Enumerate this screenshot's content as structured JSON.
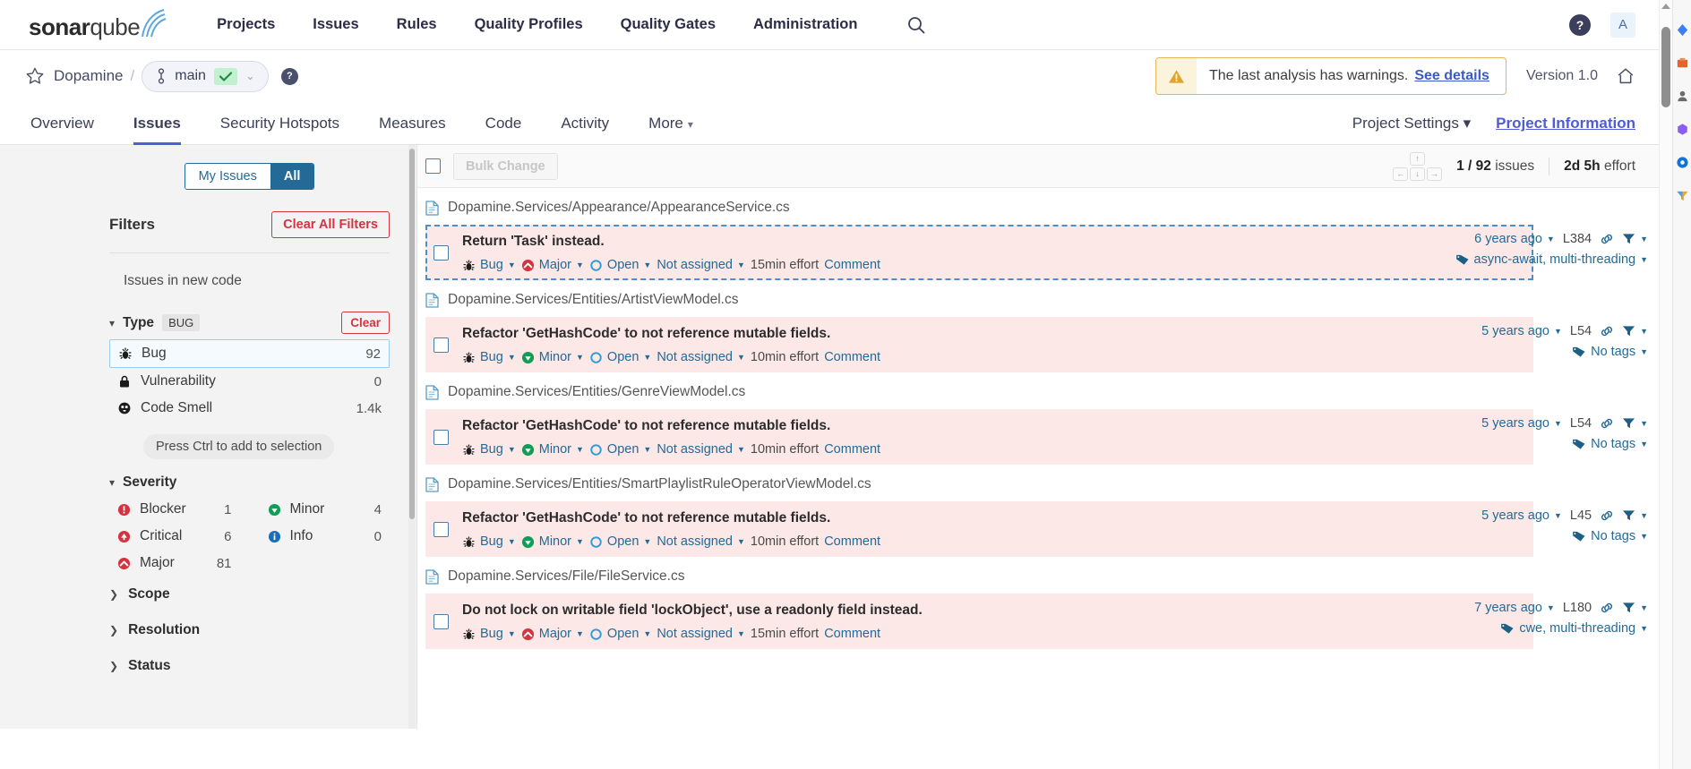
{
  "global_nav": {
    "logo_bold": "sonar",
    "logo_light": "qube",
    "links": [
      {
        "label": "Projects",
        "name": "nav-projects"
      },
      {
        "label": "Issues",
        "name": "nav-issues"
      },
      {
        "label": "Rules",
        "name": "nav-rules"
      },
      {
        "label": "Quality Profiles",
        "name": "nav-quality-profiles"
      },
      {
        "label": "Quality Gates",
        "name": "nav-quality-gates"
      },
      {
        "label": "Administration",
        "name": "nav-administration"
      }
    ],
    "search_icon": "search-icon",
    "help_label": "?",
    "avatar_label": "A"
  },
  "context": {
    "star_icon": "star-icon",
    "project_name": "Dopamine",
    "separator": "/",
    "branch": "main",
    "branch_status_icon": "check-icon",
    "branch_chevron": "⌄",
    "help_badge": "?",
    "warning_text": "The last analysis has warnings.",
    "warning_link": "See details",
    "warning_icon": "warning-triangle-icon",
    "version": "Version 1.0",
    "home_icon": "home-icon"
  },
  "tabs": {
    "items": [
      {
        "label": "Overview",
        "name": "tab-overview",
        "active": false
      },
      {
        "label": "Issues",
        "name": "tab-issues",
        "active": true
      },
      {
        "label": "Security Hotspots",
        "name": "tab-security-hotspots",
        "active": false
      },
      {
        "label": "Measures",
        "name": "tab-measures",
        "active": false
      },
      {
        "label": "Code",
        "name": "tab-code",
        "active": false
      },
      {
        "label": "Activity",
        "name": "tab-activity",
        "active": false
      },
      {
        "label": "More",
        "name": "tab-more",
        "active": false,
        "chevron": true
      }
    ],
    "project_settings": "Project Settings",
    "project_settings_chevron": "⌄",
    "project_information": "Project Information"
  },
  "sidebar": {
    "segment": {
      "my_issues": "My Issues",
      "all": "All",
      "active": "All"
    },
    "filters_title": "Filters",
    "clear_all_label": "Clear All Filters",
    "new_code_label": "Issues in new code",
    "type_facet": {
      "title": "Type",
      "chip": "BUG",
      "clear_label": "Clear",
      "items": [
        {
          "label": "Bug",
          "count": "92",
          "icon": "bug-icon",
          "selected": true
        },
        {
          "label": "Vulnerability",
          "count": "0",
          "icon": "vulnerability-icon",
          "selected": false
        },
        {
          "label": "Code Smell",
          "count": "1.4k",
          "icon": "code-smell-icon",
          "selected": false
        }
      ]
    },
    "hint": "Press Ctrl to add to selection",
    "severity_facet": {
      "title": "Severity",
      "items": [
        {
          "label": "Blocker",
          "count": "1",
          "icon": "blocker-icon"
        },
        {
          "label": "Minor",
          "count": "4",
          "icon": "minor-icon"
        },
        {
          "label": "Critical",
          "count": "6",
          "icon": "critical-icon"
        },
        {
          "label": "Info",
          "count": "0",
          "icon": "info-icon"
        },
        {
          "label": "Major",
          "count": "81",
          "icon": "major-icon"
        }
      ]
    },
    "collapsed_facets": [
      {
        "label": "Scope",
        "name": "facet-scope"
      },
      {
        "label": "Resolution",
        "name": "facet-resolution"
      },
      {
        "label": "Status",
        "name": "facet-status"
      }
    ]
  },
  "list_toolbar": {
    "bulk_change_label": "Bulk Change",
    "keys": {
      "up": "↑",
      "left": "←",
      "down": "↓",
      "right": "→"
    },
    "count_current": "1 / 92",
    "count_suffix": "issues",
    "effort_value": "2d 5h",
    "effort_suffix": "effort"
  },
  "issues": [
    {
      "file": "Dopamine.Services/Appearance/AppearanceService.cs",
      "title": "Return 'Task' instead.",
      "type": "Bug",
      "type_icon": "bug-icon",
      "severity": "Major",
      "severity_icon": "major-icon",
      "status": "Open",
      "status_icon": "open-circle-icon",
      "assignee": "Not assigned",
      "effort": "15min effort",
      "comment": "Comment",
      "age": "6 years ago",
      "line": "L384",
      "link_icon": "permalink-icon",
      "filter_icon": "filter-icon",
      "tags_icon": "tag-icon",
      "tags": "async-await, multi-threading",
      "selected": true
    },
    {
      "file": "Dopamine.Services/Entities/ArtistViewModel.cs",
      "title": "Refactor 'GetHashCode' to not reference mutable fields.",
      "type": "Bug",
      "type_icon": "bug-icon",
      "severity": "Minor",
      "severity_icon": "minor-icon",
      "status": "Open",
      "status_icon": "open-circle-icon",
      "assignee": "Not assigned",
      "effort": "10min effort",
      "comment": "Comment",
      "age": "5 years ago",
      "line": "L54",
      "link_icon": "permalink-icon",
      "filter_icon": "filter-icon",
      "tags_icon": "tag-icon",
      "tags": "No tags",
      "selected": false
    },
    {
      "file": "Dopamine.Services/Entities/GenreViewModel.cs",
      "title": "Refactor 'GetHashCode' to not reference mutable fields.",
      "type": "Bug",
      "type_icon": "bug-icon",
      "severity": "Minor",
      "severity_icon": "minor-icon",
      "status": "Open",
      "status_icon": "open-circle-icon",
      "assignee": "Not assigned",
      "effort": "10min effort",
      "comment": "Comment",
      "age": "5 years ago",
      "line": "L54",
      "link_icon": "permalink-icon",
      "filter_icon": "filter-icon",
      "tags_icon": "tag-icon",
      "tags": "No tags",
      "selected": false
    },
    {
      "file": "Dopamine.Services/Entities/SmartPlaylistRuleOperatorViewModel.cs",
      "title": "Refactor 'GetHashCode' to not reference mutable fields.",
      "type": "Bug",
      "type_icon": "bug-icon",
      "severity": "Minor",
      "severity_icon": "minor-icon",
      "status": "Open",
      "status_icon": "open-circle-icon",
      "assignee": "Not assigned",
      "effort": "10min effort",
      "comment": "Comment",
      "age": "5 years ago",
      "line": "L45",
      "link_icon": "permalink-icon",
      "filter_icon": "filter-icon",
      "tags_icon": "tag-icon",
      "tags": "No tags",
      "selected": false
    },
    {
      "file": "Dopamine.Services/File/FileService.cs",
      "title": "Do not lock on writable field 'lockObject', use a readonly field instead.",
      "type": "Bug",
      "type_icon": "bug-icon",
      "severity": "Major",
      "severity_icon": "major-icon",
      "status": "Open",
      "status_icon": "open-circle-icon",
      "assignee": "Not assigned",
      "effort": "15min effort",
      "comment": "Comment",
      "age": "7 years ago",
      "line": "L180",
      "link_icon": "permalink-icon",
      "filter_icon": "filter-icon",
      "tags_icon": "tag-icon",
      "tags": "cwe, multi-threading",
      "selected": false
    }
  ],
  "colors": {
    "accent_blue": "#4c5dd5",
    "link_teal": "#236a97",
    "danger_red": "#d4333f",
    "issue_bg": "#fbe8e7",
    "warn_border": "#e2b75b",
    "minor_green": "#0f9d58",
    "info_blue": "#1c6fb5"
  }
}
